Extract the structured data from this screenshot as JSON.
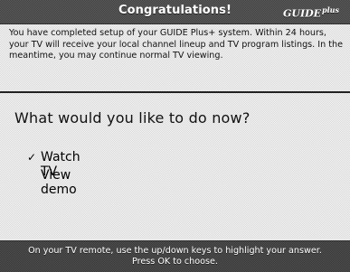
{
  "header": {
    "title": "Congratulations!",
    "logo_text": "GUIDE",
    "logo_suffix": "plus"
  },
  "message": {
    "text": "You have completed setup of your GUIDE Plus+ system.  Within 24 hours, your TV will receive your local channel lineup and TV program listings.  In the meantime, you may continue normal TV viewing."
  },
  "prompt": {
    "question": "What would you like to do now?"
  },
  "menu": {
    "items": [
      {
        "label": "Watch TV",
        "checked": true,
        "check_mark": "✓"
      },
      {
        "label": "View demo",
        "checked": false
      }
    ]
  },
  "footer": {
    "line1": "On your TV remote, use the up/down keys to highlight your answer.",
    "line2": "Press OK to choose."
  },
  "colors": {
    "bar_gray": "#5a5a5a",
    "background": "#f3f3f3",
    "divider": "#222222"
  }
}
